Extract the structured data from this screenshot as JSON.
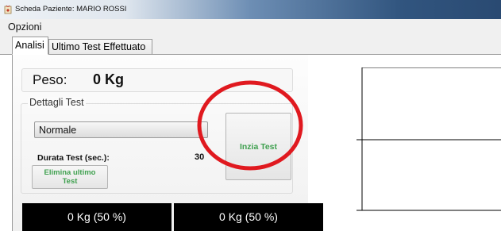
{
  "window": {
    "title": "Scheda Paziente: MARIO ROSSI",
    "app_icon": "app-icon"
  },
  "menu": {
    "items": [
      {
        "label": "Opzioni"
      }
    ]
  },
  "tabs": [
    {
      "label": "Analisi",
      "active": true
    },
    {
      "label": "Ultimo Test Effettuato",
      "active": false
    }
  ],
  "weight": {
    "label": "Peso:",
    "value": "0 Kg"
  },
  "test_details": {
    "group_label": "Dettagli Test",
    "mode_select": {
      "value": "Normale"
    },
    "duration": {
      "label": "Durata Test (sec.):",
      "value": "30"
    },
    "delete_button": {
      "line1": "Elimina ultimo",
      "line2": "Test"
    },
    "start_button": {
      "label": "Inzia Test"
    }
  },
  "displays": [
    {
      "value": "0 Kg (50 %)"
    },
    {
      "value": "0 Kg (50 %)"
    }
  ],
  "colors": {
    "button_text": "#3fa04f",
    "annotation": "#e0191f",
    "display_bg": "#000000"
  }
}
